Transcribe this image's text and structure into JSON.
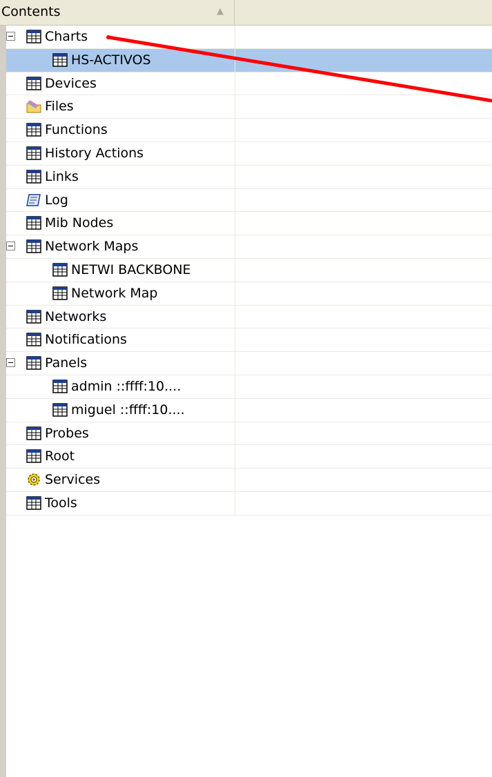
{
  "header": {
    "title": "Contents",
    "sort_indicator": "▲"
  },
  "tree": [
    {
      "id": "charts",
      "label": "Charts",
      "level": 0,
      "expander": "collapse",
      "icon": "table-icon"
    },
    {
      "id": "hs-activos",
      "label": "HS-ACTIVOS",
      "level": 1,
      "icon": "table-icon",
      "selected": true
    },
    {
      "id": "devices",
      "label": "Devices",
      "level": 0,
      "icon": "table-icon"
    },
    {
      "id": "files",
      "label": "Files",
      "level": 0,
      "icon": "folder-icon"
    },
    {
      "id": "functions",
      "label": "Functions",
      "level": 0,
      "icon": "table-icon"
    },
    {
      "id": "history-actions",
      "label": "History Actions",
      "level": 0,
      "icon": "table-icon"
    },
    {
      "id": "links",
      "label": "Links",
      "level": 0,
      "icon": "table-icon"
    },
    {
      "id": "log",
      "label": "Log",
      "level": 0,
      "icon": "log-icon"
    },
    {
      "id": "mib-nodes",
      "label": "Mib Nodes",
      "level": 0,
      "icon": "table-icon"
    },
    {
      "id": "network-maps",
      "label": "Network Maps",
      "level": 0,
      "expander": "collapse",
      "icon": "table-icon"
    },
    {
      "id": "netwi-backbone",
      "label": "NETWI BACKBONE",
      "level": 1,
      "icon": "table-icon"
    },
    {
      "id": "network-map",
      "label": "Network Map",
      "level": 1,
      "icon": "table-icon"
    },
    {
      "id": "networks",
      "label": "Networks",
      "level": 0,
      "icon": "table-icon"
    },
    {
      "id": "notifications",
      "label": "Notifications",
      "level": 0,
      "icon": "table-icon"
    },
    {
      "id": "panels",
      "label": "Panels",
      "level": 0,
      "expander": "collapse",
      "icon": "table-icon"
    },
    {
      "id": "admin",
      "label": "admin ::ffff:10....",
      "level": 1,
      "icon": "table-icon"
    },
    {
      "id": "miguel",
      "label": "miguel ::ffff:10....",
      "level": 1,
      "icon": "table-icon"
    },
    {
      "id": "probes",
      "label": "Probes",
      "level": 0,
      "icon": "table-icon"
    },
    {
      "id": "root",
      "label": "Root",
      "level": 0,
      "icon": "table-icon"
    },
    {
      "id": "services",
      "label": "Services",
      "level": 0,
      "icon": "gear-icon"
    },
    {
      "id": "tools",
      "label": "Tools",
      "level": 0,
      "icon": "table-icon"
    }
  ],
  "colors": {
    "selection": "#a9c8ec",
    "annotation_arrow": "#ff0000",
    "header_bg": "#ece9d8"
  }
}
